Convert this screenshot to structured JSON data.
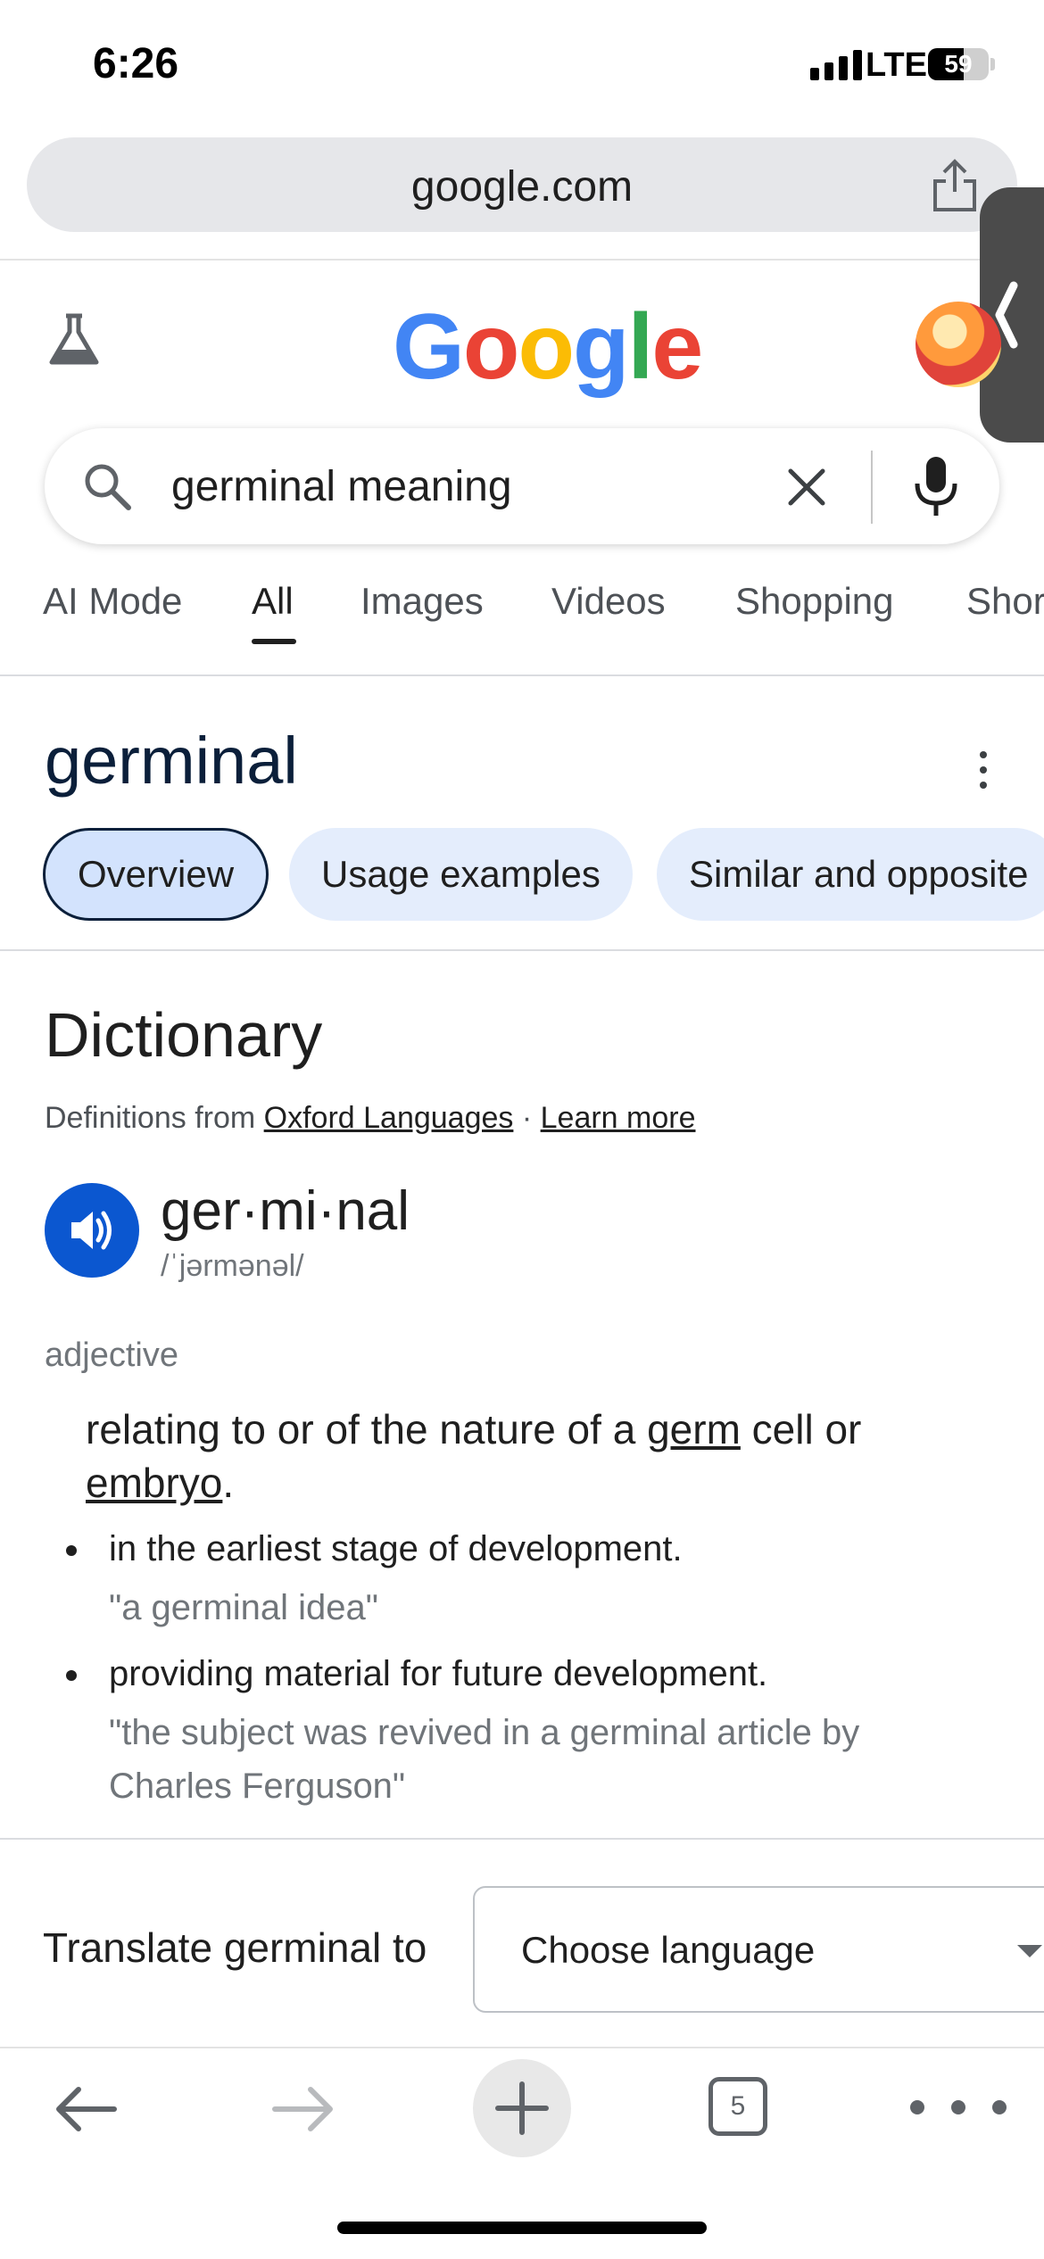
{
  "status_bar": {
    "time": "6:26",
    "network": "LTE",
    "battery": "59",
    "battery_level": 0.59
  },
  "browser": {
    "url": "google.com"
  },
  "google": {
    "logo_letters": [
      "G",
      "o",
      "o",
      "g",
      "l",
      "e"
    ],
    "logo_colors": [
      "#4285F4",
      "#EA4335",
      "#FBBC05",
      "#4285F4",
      "#34A853",
      "#EA4335"
    ]
  },
  "search": {
    "query": "germinal meaning"
  },
  "tabs": [
    {
      "label": "AI Mode",
      "active": false
    },
    {
      "label": "All",
      "active": true
    },
    {
      "label": "Images",
      "active": false
    },
    {
      "label": "Videos",
      "active": false
    },
    {
      "label": "Shopping",
      "active": false
    },
    {
      "label": "Shor",
      "active": false
    }
  ],
  "entity": {
    "title": "germinal",
    "chips": [
      {
        "label": "Overview",
        "active": true
      },
      {
        "label": "Usage examples",
        "active": false
      },
      {
        "label": "Similar and opposite",
        "active": false
      }
    ]
  },
  "dictionary": {
    "heading": "Dictionary",
    "source_prefix": "Definitions from ",
    "source_link": "Oxford Languages",
    "source_sep": " · ",
    "learn_more": "Learn more",
    "word": "ger·mi·nal",
    "phonetic": "/ˈjərmənəl/",
    "part_of_speech": "adjective",
    "definition": {
      "text_1": "relating to or of the nature of a ",
      "link_1": "germ",
      "text_2": " cell or ",
      "link_2": "embryo",
      "text_3": "."
    },
    "senses": [
      {
        "sense": "in the earliest stage of development.",
        "example": "\"a germinal idea\""
      },
      {
        "sense": "providing material for future development.",
        "example": "\"the subject was revived in a germinal article by Charles Ferguson\""
      }
    ]
  },
  "translate": {
    "label": "Translate germinal to",
    "placeholder": "Choose language"
  },
  "toolbar": {
    "tab_count": "5"
  },
  "colors": {
    "accent_blue": "#0b57d0",
    "chip_bg": "#e4edfc",
    "text_dark": "#1f1f1f"
  }
}
